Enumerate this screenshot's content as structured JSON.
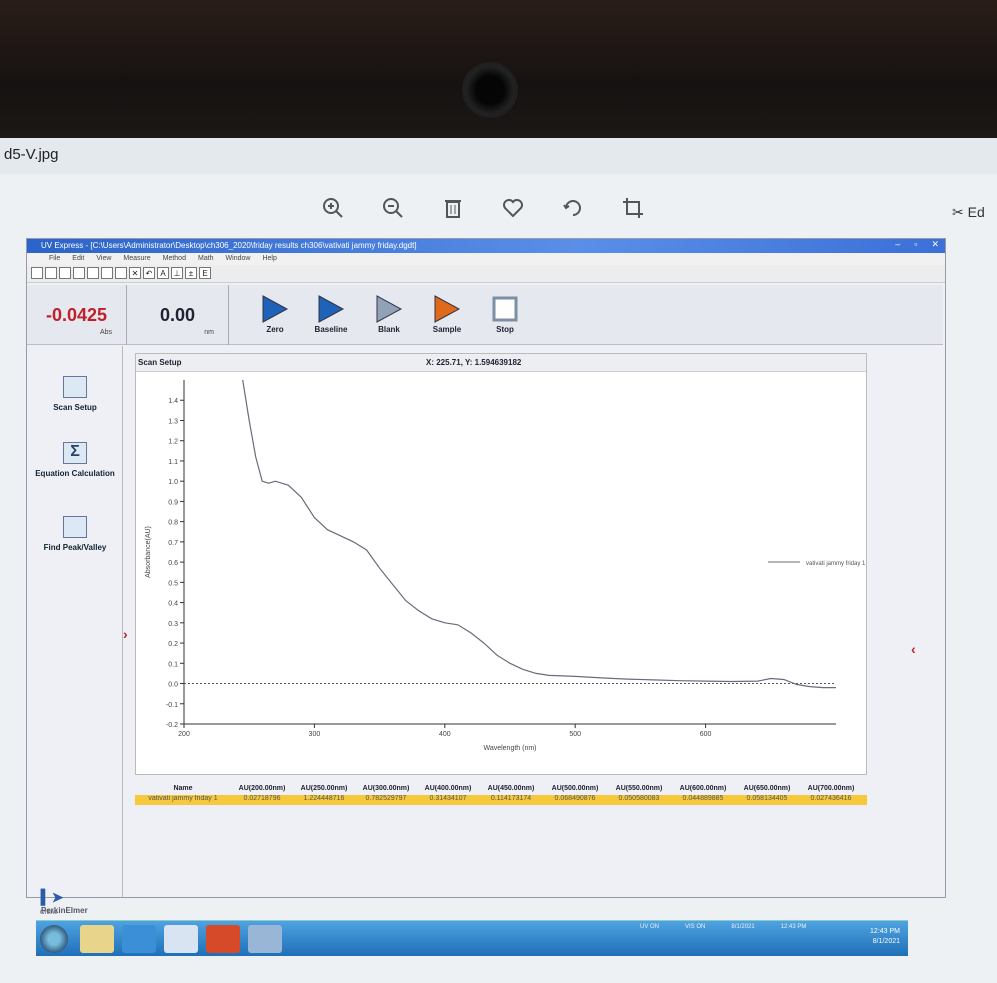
{
  "viewer": {
    "filename": "d5-V.jpg",
    "edit_label": "Ed"
  },
  "app": {
    "title": "UV Express - [C:\\Users\\Administrator\\Desktop\\ch306_2020\\friday results ch306\\vativati jammy friday.dgdt]",
    "menu": [
      "File",
      "Edit",
      "View",
      "Measure",
      "Method",
      "Math",
      "Window",
      "Help"
    ],
    "readout_abs": {
      "value": "-0.0425",
      "unit": "Abs"
    },
    "readout_nm": {
      "value": "0.00",
      "unit": "nm"
    },
    "actions": [
      {
        "label": "Zero",
        "color": "#1e63b8"
      },
      {
        "label": "Baseline",
        "color": "#1e63b8"
      },
      {
        "label": "Blank",
        "color": "#8fa2b8"
      },
      {
        "label": "Sample",
        "color": "#e06a1a"
      },
      {
        "label": "Stop",
        "color": "#7d8fa3"
      }
    ],
    "sidebar": [
      {
        "label": "Scan Setup"
      },
      {
        "label": "Equation Calculation"
      },
      {
        "label": "Find Peak/Valley"
      }
    ],
    "graph_toolbar_label": "Scan Setup",
    "cursor_coords": "X: 225.71,  Y: 1.594639182",
    "brand": "PerkinElmer",
    "online": "Online"
  },
  "chart_data": {
    "type": "line",
    "xlabel": "Wavelength (nm)",
    "ylabel": "Absorbance(AU)",
    "xlim": [
      200,
      700
    ],
    "ylim": [
      -0.2,
      1.5
    ],
    "xticks": [
      "200",
      "300",
      "400",
      "500",
      "600"
    ],
    "yticks": [
      "-0.2",
      "-0.1",
      "0.0",
      "0.1",
      "0.2",
      "0.3",
      "0.4",
      "0.5",
      "0.6",
      "0.7",
      "0.8",
      "0.9",
      "1.0",
      "1.1",
      "1.2",
      "1.3",
      "1.4"
    ],
    "grid": false,
    "legend": "right",
    "series": [
      {
        "name": "vativati jammy friday  1",
        "color": "#6b6b7a",
        "x": [
          245,
          250,
          255,
          260,
          265,
          270,
          280,
          290,
          300,
          310,
          320,
          330,
          340,
          350,
          360,
          370,
          380,
          390,
          400,
          410,
          420,
          430,
          440,
          450,
          460,
          470,
          480,
          500,
          520,
          540,
          560,
          580,
          600,
          620,
          640,
          650,
          660,
          670,
          680,
          690,
          700
        ],
        "y": [
          1.5,
          1.3,
          1.12,
          1.0,
          0.99,
          1.0,
          0.98,
          0.92,
          0.82,
          0.76,
          0.73,
          0.7,
          0.66,
          0.57,
          0.49,
          0.41,
          0.36,
          0.32,
          0.3,
          0.29,
          0.25,
          0.2,
          0.14,
          0.1,
          0.07,
          0.05,
          0.04,
          0.035,
          0.028,
          0.022,
          0.018,
          0.014,
          0.012,
          0.01,
          0.012,
          0.025,
          0.02,
          -0.005,
          -0.015,
          -0.02,
          -0.02
        ]
      }
    ],
    "baseline_y": 0.0
  },
  "results_table": {
    "headers": [
      "Name",
      "AU(200.00nm)",
      "AU(250.00nm)",
      "AU(300.00nm)",
      "AU(400.00nm)",
      "AU(450.00nm)",
      "AU(500.00nm)",
      "AU(550.00nm)",
      "AU(600.00nm)",
      "AU(650.00nm)",
      "AU(700.00nm)"
    ],
    "row": [
      "vativati jammy friday  1",
      "0.02718796",
      "1.224448716",
      "0.782529797",
      "0.31434107",
      "0.114173174",
      "0.068490876",
      "0.050580083",
      "0.044889885",
      "0.058134405",
      "0.027436416"
    ]
  },
  "taskbar": {
    "status": [
      "UV ON",
      "VIS ON",
      "8/1/2021",
      "12:43 PM"
    ],
    "clock_time": "12:43 PM",
    "clock_date": "8/1/2021"
  }
}
